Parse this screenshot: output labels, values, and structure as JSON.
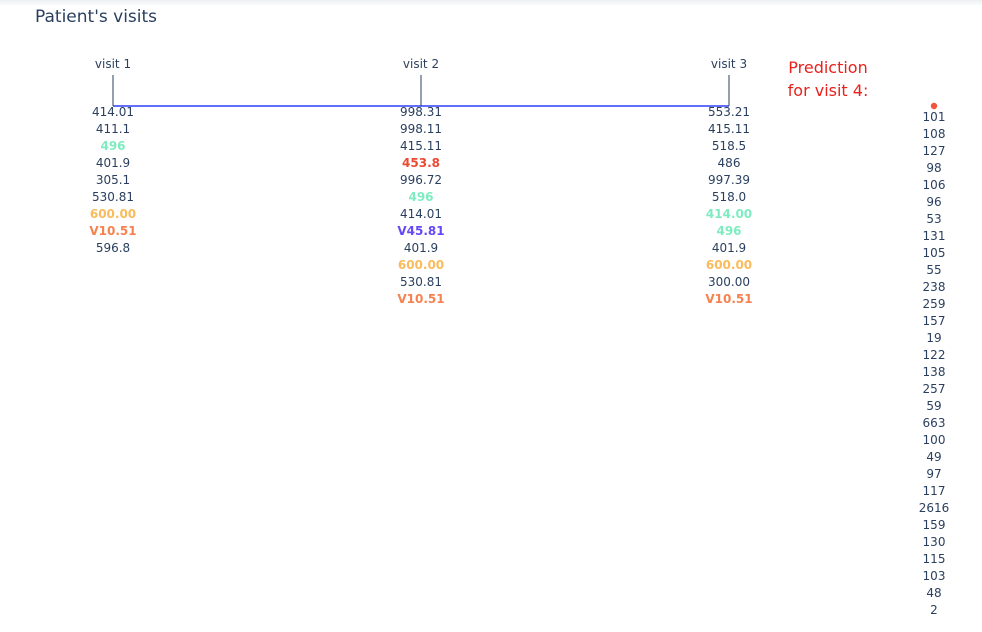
{
  "title": "Patient's visits",
  "prediction": {
    "line1": "Prediction",
    "line2": "for visit 4:"
  },
  "chart_data": {
    "type": "timeline",
    "visits": [
      {
        "label": "visit 1",
        "codes": [
          {
            "code": "414.01",
            "color": "#2a3f5f",
            "bold": false
          },
          {
            "code": "411.1",
            "color": "#2a3f5f",
            "bold": false
          },
          {
            "code": "496",
            "color": "#7eecc0",
            "bold": true
          },
          {
            "code": "401.9",
            "color": "#2a3f5f",
            "bold": false
          },
          {
            "code": "305.1",
            "color": "#2a3f5f",
            "bold": false
          },
          {
            "code": "530.81",
            "color": "#2a3f5f",
            "bold": false
          },
          {
            "code": "600.00",
            "color": "#f9bb5b",
            "bold": true
          },
          {
            "code": "V10.51",
            "color": "#f5824f",
            "bold": true
          },
          {
            "code": "596.8",
            "color": "#2a3f5f",
            "bold": false
          }
        ]
      },
      {
        "label": "visit 2",
        "codes": [
          {
            "code": "998.31",
            "color": "#2a3f5f",
            "bold": false
          },
          {
            "code": "998.11",
            "color": "#2a3f5f",
            "bold": false
          },
          {
            "code": "415.11",
            "color": "#2a3f5f",
            "bold": false
          },
          {
            "code": "453.8",
            "color": "#ec4a32",
            "bold": true
          },
          {
            "code": "996.72",
            "color": "#2a3f5f",
            "bold": false
          },
          {
            "code": "496",
            "color": "#7eecc0",
            "bold": true
          },
          {
            "code": "414.01",
            "color": "#2a3f5f",
            "bold": false
          },
          {
            "code": "V45.81",
            "color": "#6349f5",
            "bold": true
          },
          {
            "code": "401.9",
            "color": "#2a3f5f",
            "bold": false
          },
          {
            "code": "600.00",
            "color": "#f9bb5b",
            "bold": true
          },
          {
            "code": "530.81",
            "color": "#2a3f5f",
            "bold": false
          },
          {
            "code": "V10.51",
            "color": "#f5824f",
            "bold": true
          }
        ]
      },
      {
        "label": "visit 3",
        "codes": [
          {
            "code": "553.21",
            "color": "#2a3f5f",
            "bold": false
          },
          {
            "code": "415.11",
            "color": "#2a3f5f",
            "bold": false
          },
          {
            "code": "518.5",
            "color": "#2a3f5f",
            "bold": false
          },
          {
            "code": "486",
            "color": "#2a3f5f",
            "bold": false
          },
          {
            "code": "997.39",
            "color": "#2a3f5f",
            "bold": false
          },
          {
            "code": "518.0",
            "color": "#2a3f5f",
            "bold": false
          },
          {
            "code": "414.00",
            "color": "#7eecc0",
            "bold": true
          },
          {
            "code": "496",
            "color": "#7eecc0",
            "bold": true
          },
          {
            "code": "401.9",
            "color": "#2a3f5f",
            "bold": false
          },
          {
            "code": "600.00",
            "color": "#f9bb5b",
            "bold": true
          },
          {
            "code": "300.00",
            "color": "#2a3f5f",
            "bold": false
          },
          {
            "code": "V10.51",
            "color": "#f5824f",
            "bold": true
          }
        ]
      }
    ],
    "prediction_values": [
      "101",
      "108",
      "127",
      "98",
      "106",
      "96",
      "53",
      "131",
      "105",
      "55",
      "238",
      "259",
      "157",
      "19",
      "122",
      "138",
      "257",
      "59",
      "663",
      "100",
      "49",
      "97",
      "117",
      "2616",
      "159",
      "130",
      "115",
      "103",
      "48",
      "2"
    ],
    "colors": {
      "line": "#636efa",
      "text": "#2a3f5f",
      "tick": "#2a3f5f",
      "marker": "#ef553b"
    }
  }
}
